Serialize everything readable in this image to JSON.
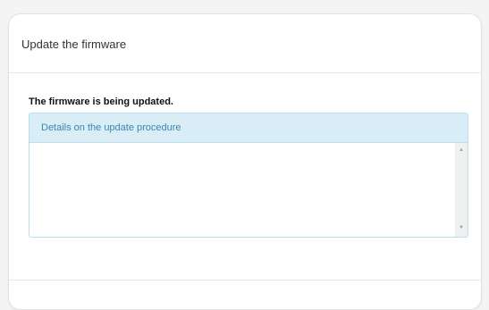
{
  "dialog": {
    "title": "Update the firmware",
    "status": "The firmware is being updated.",
    "details": {
      "heading": "Details on the update procedure",
      "log_text": ""
    },
    "scrollbar": {
      "up_icon": "scroll-up-arrow-icon",
      "down_icon": "scroll-down-arrow-icon",
      "up_glyph": "▲",
      "down_glyph": "▼"
    }
  },
  "colors": {
    "panel_heading_bg": "#d9edf7",
    "panel_heading_text": "#3a87ad",
    "panel_border": "#bcdde9"
  }
}
